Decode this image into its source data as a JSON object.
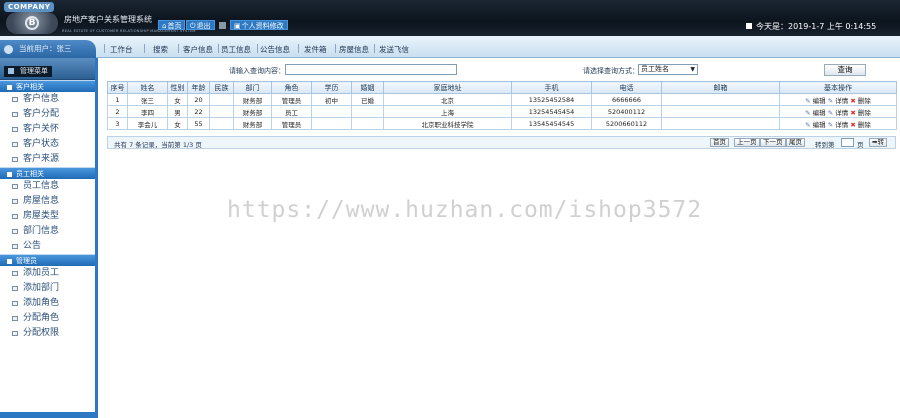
{
  "header": {
    "company": "COMPANY",
    "title": "房地产客户关系管理系统",
    "subtitle": "REAL ESTATE OF CUSTOMER RELATIONSHIP MANAGEMENT SYSTEM",
    "home_label": "首页",
    "logout_label": "退出",
    "profile_label": "个人资料修改",
    "date_text": "今天是：2019-1-7 上午 0:14:55"
  },
  "nav": {
    "current_user": "当前用户：张三",
    "items": [
      "工作台",
      "搜索",
      "客户信息",
      "员工信息",
      "公告信息",
      "发件箱",
      "房屋信息",
      "发送飞信"
    ]
  },
  "sidebar": {
    "menu_title": "管理菜单",
    "groups": [
      {
        "title": "客户相关",
        "items": [
          "客户信息",
          "客户分配",
          "客户关怀",
          "客户状态",
          "客户来源"
        ]
      },
      {
        "title": "员工相关",
        "items": [
          "员工信息",
          "房屋信息",
          "房屋类型",
          "部门信息",
          "公告"
        ]
      },
      {
        "title": "管理员",
        "items": [
          "添加员工",
          "添加部门",
          "添加角色",
          "分配角色",
          "分配权限"
        ]
      }
    ]
  },
  "search": {
    "query_label": "请输入查询内容：",
    "query_value": "",
    "mode_label": "请选择查询方式：",
    "mode_selected": "员工姓名",
    "submit_label": "查询"
  },
  "table": {
    "headers": [
      "序号",
      "姓名",
      "性别",
      "年龄",
      "民族",
      "部门",
      "角色",
      "学历",
      "婚姻",
      "家庭地址",
      "手机",
      "电话",
      "邮箱",
      "基本操作"
    ],
    "rows": [
      [
        "1",
        "张三",
        "女",
        "20",
        "",
        "财务部",
        "管理员",
        "初中",
        "已婚",
        "北京",
        "13525452584",
        "6666666",
        ""
      ],
      [
        "2",
        "李四",
        "男",
        "22",
        "",
        "财务部",
        "员工",
        "",
        "",
        "上海",
        "13254545454",
        "520400112",
        ""
      ],
      [
        "3",
        "李会儿",
        "女",
        "55",
        "",
        "财务部",
        "管理员",
        "",
        "",
        "北京职业科技学院",
        "13545454545",
        "5200660112",
        ""
      ]
    ],
    "ops": {
      "edit": "编辑",
      "detail": "详情",
      "delete": "删除"
    }
  },
  "pager": {
    "info": "共有 7 条记录，当前第 1/3 页",
    "first": "首页",
    "prev": "上一页",
    "next": "下一页",
    "last": "尾页",
    "goto_label": "转到第",
    "page_unit": "页",
    "go": "➡转"
  },
  "watermark": "https://www.huzhan.com/ishop3572",
  "colors": {
    "accent": "#2d78c2",
    "header_bg": "#0c141d"
  }
}
